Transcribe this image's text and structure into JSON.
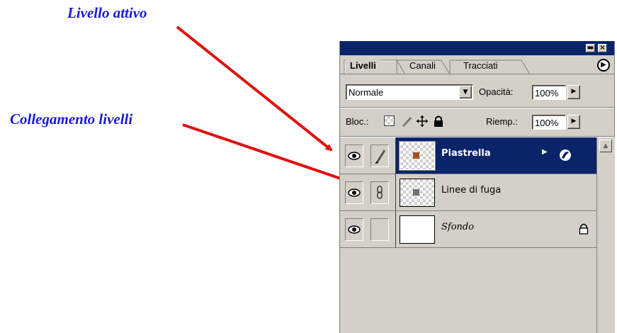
{
  "annotations": {
    "active_layer": "Livello attivo",
    "layer_link": "Collegamento livelli"
  },
  "panel": {
    "tabs": [
      "Livelli",
      "Canali",
      "Tracciati"
    ],
    "blend_mode": "Normale",
    "opacity_label": "Opacità:",
    "opacity_value": "100%",
    "lock_label": "Bloc.:",
    "fill_label": "Riemp.:",
    "fill_value": "100%"
  },
  "layers": [
    {
      "name": "Piastrella",
      "selected": true,
      "thumb_dot": "#a0521c",
      "visible": true,
      "cell_icon": "brush-icon"
    },
    {
      "name": "Linee di fuga",
      "selected": false,
      "thumb_dot": "#707070",
      "visible": true,
      "cell_icon": "chain-link-icon"
    },
    {
      "name": "Sfondo",
      "selected": false,
      "visible": true,
      "locked": true
    }
  ],
  "colors": {
    "annotation_text": "#1a1ad8",
    "arrow": "#e01010",
    "title_bar": "#0a246a",
    "selected_row": "#0a246a",
    "panel_bg": "#d4d0c8"
  }
}
